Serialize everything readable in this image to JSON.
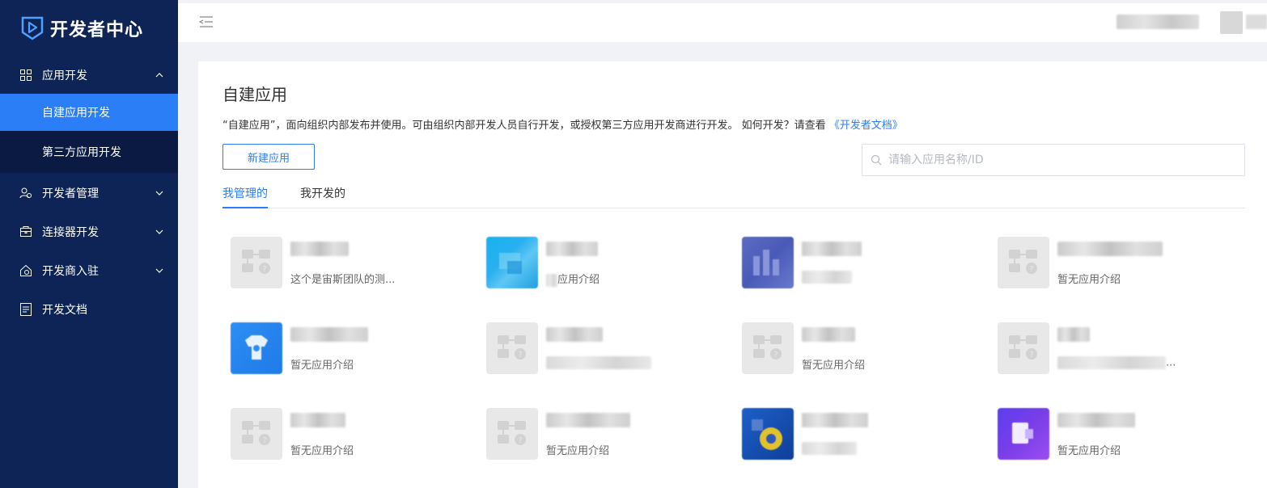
{
  "brand": {
    "title": "开发者中心",
    "logo_icon": "play-shield-icon"
  },
  "sidebar": {
    "groups": [
      {
        "label": "应用开发",
        "icon": "grid-icon",
        "expanded": true
      },
      {
        "label": "开发者管理",
        "icon": "people-icon",
        "expanded": false
      },
      {
        "label": "连接器开发",
        "icon": "box-icon",
        "expanded": false
      },
      {
        "label": "开发商入驻",
        "icon": "house-icon",
        "expanded": false
      },
      {
        "label": "开发文档",
        "icon": "doc-icon"
      }
    ],
    "sub_items": [
      {
        "label": "自建应用开发",
        "active": true
      },
      {
        "label": "第三方应用开发",
        "active": false
      }
    ]
  },
  "header": {
    "collapse_icon": "menu-collapse-icon"
  },
  "main": {
    "title": "自建应用",
    "description": "“自建应用”，面向组织内部发布并使用。可由组织内部开发人员自行开发，或授权第三方应用开发商进行开发。  如何开发？请查看 ",
    "doc_link": "《开发者文档》",
    "new_button": "新建应用",
    "search_placeholder": "请输入应用名称/ID",
    "tabs": [
      {
        "label": "我管理的",
        "active": true
      },
      {
        "label": "我开发的",
        "active": false
      }
    ],
    "apps": [
      {
        "name": "",
        "desc": "这个是宙斯团队的测...",
        "icon": "default-app-icon"
      },
      {
        "name": "",
        "desc": "应用介绍",
        "icon": "cyan-app-icon"
      },
      {
        "name": "",
        "desc": "",
        "icon": "indigo-app-icon"
      },
      {
        "name": "",
        "desc": "暂无应用介绍",
        "icon": "default-app-icon"
      },
      {
        "name": "",
        "desc": "暂无应用介绍",
        "icon": "blue-shirt-app-icon"
      },
      {
        "name": "",
        "desc": "",
        "icon": "default-app-icon"
      },
      {
        "name": "",
        "desc": "暂无应用介绍",
        "icon": "default-app-icon"
      },
      {
        "name": "",
        "desc": "...",
        "icon": "default-app-icon"
      },
      {
        "name": "",
        "desc": "暂无应用介绍",
        "icon": "default-app-icon"
      },
      {
        "name": "",
        "desc": "暂无应用介绍",
        "icon": "default-app-icon"
      },
      {
        "name": "",
        "desc": "",
        "icon": "yellow-blue-app-icon"
      },
      {
        "name": "",
        "desc": "暂无应用介绍",
        "icon": "purple-app-icon"
      }
    ]
  },
  "colors": {
    "sidebar": "#0f2456",
    "accent": "#2b7ef5",
    "subnav_bg": "#0a1a42"
  }
}
